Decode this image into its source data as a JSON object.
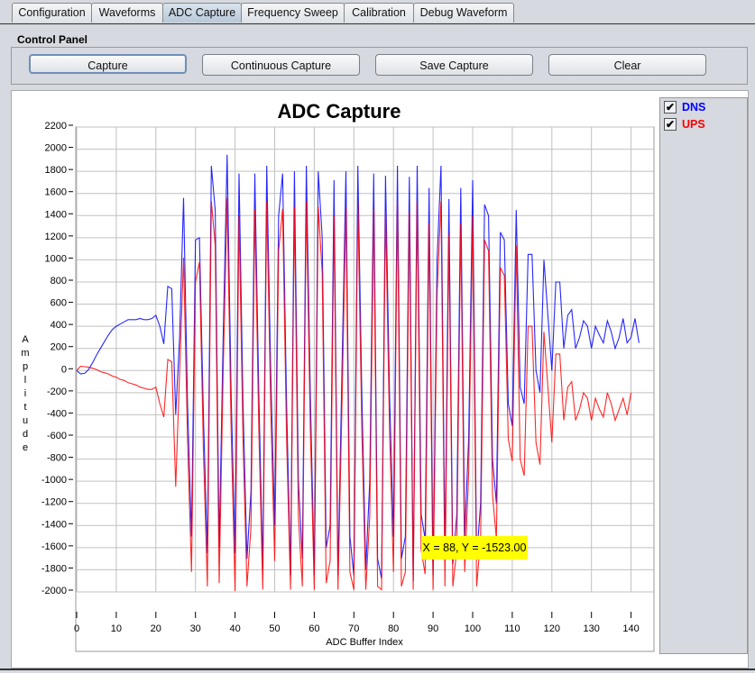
{
  "tabs": [
    {
      "label": "Configuration"
    },
    {
      "label": "Waveforms"
    },
    {
      "label": "ADC Capture",
      "active": true
    },
    {
      "label": "Frequency Sweep"
    },
    {
      "label": "Calibration"
    },
    {
      "label": "Debug Waveform"
    }
  ],
  "control_panel": {
    "title": "Control Panel",
    "buttons": {
      "capture": "Capture",
      "continuous": "Continuous Capture",
      "save": "Save Capture",
      "clear": "Clear"
    }
  },
  "legend": {
    "items": [
      {
        "label": "DNS",
        "checked": true,
        "color": "#0000ff"
      },
      {
        "label": "UPS",
        "checked": true,
        "color": "#ff0000"
      }
    ]
  },
  "tooltip": {
    "text": "X = 88, Y = -1523.00"
  },
  "chart_data": {
    "type": "line",
    "title": "ADC Capture",
    "xlabel": "ADC Buffer Index",
    "ylabel": "Amplitude",
    "xlim": [
      0,
      144
    ],
    "ylim": [
      -2000,
      2200
    ],
    "xticks": [
      0,
      10,
      20,
      30,
      40,
      50,
      60,
      70,
      80,
      90,
      100,
      110,
      120,
      130,
      140
    ],
    "yticks": [
      2200,
      2000,
      1800,
      1600,
      1400,
      1200,
      1000,
      800,
      600,
      400,
      200,
      0,
      -200,
      -400,
      -600,
      -800,
      -1000,
      -1200,
      -1400,
      -1600,
      -1800,
      -2000
    ],
    "grid": true,
    "legend_position": "right",
    "series": [
      {
        "name": "DNS",
        "color": "#0000ff",
        "values": [
          0,
          -30,
          -25,
          10,
          70,
          140,
          200,
          260,
          320,
          370,
          400,
          420,
          440,
          460,
          460,
          460,
          470,
          460,
          460,
          470,
          500,
          400,
          240,
          760,
          740,
          -400,
          300,
          1560,
          -300,
          -1500,
          1180,
          1200,
          -400,
          -1650,
          1850,
          1450,
          -1600,
          300,
          1950,
          -200,
          -1650,
          1780,
          -300,
          -1700,
          -1100,
          1780,
          -200,
          -1800,
          1850,
          0,
          -1400,
          1400,
          1780,
          -300,
          -1850,
          1800,
          -1000,
          -1700,
          1850,
          -200,
          -1850,
          1800,
          1200,
          -1600,
          -1400,
          1720,
          -1850,
          0,
          1800,
          -1500,
          -1850,
          1850,
          -200,
          -1800,
          -1000,
          1780,
          -1700,
          -1880,
          1760,
          -200,
          -1500,
          1850,
          -1700,
          -1500,
          1750,
          -1900,
          1850,
          -1300,
          -1523,
          1650,
          -1850,
          1000,
          1850,
          -1700,
          1550,
          -1750,
          -1300,
          1650,
          -1500,
          -600,
          1720,
          -1700,
          -1200,
          1500,
          1400,
          -800,
          -1200,
          1250,
          1180,
          -300,
          -500,
          1450,
          -150,
          -300,
          1050,
          1050,
          0,
          -200,
          1000,
          500,
          0,
          800,
          800,
          200,
          500,
          550,
          200,
          300,
          450,
          400,
          200,
          400,
          320,
          250,
          450,
          350,
          200,
          300,
          470,
          250,
          300,
          470,
          250
        ]
      },
      {
        "name": "UPS",
        "color": "#ff0000",
        "values": [
          0,
          40,
          35,
          30,
          20,
          10,
          -10,
          -20,
          -30,
          -50,
          -60,
          -80,
          -90,
          -110,
          -120,
          -130,
          -150,
          -160,
          -170,
          -170,
          -150,
          -300,
          -420,
          100,
          80,
          -1050,
          -20,
          1020,
          -620,
          -1820,
          800,
          980,
          -720,
          -1950,
          1530,
          1130,
          -1920,
          -20,
          1560,
          -520,
          -1990,
          1400,
          -620,
          -1950,
          -1420,
          1460,
          -520,
          -1980,
          1530,
          -320,
          -1720,
          1080,
          1460,
          -620,
          -1980,
          1480,
          -1320,
          -1950,
          1530,
          -520,
          -1980,
          1480,
          880,
          -1920,
          -1720,
          1400,
          -1980,
          -320,
          1480,
          -1820,
          -1980,
          1530,
          -520,
          -1980,
          -1320,
          1460,
          -1950,
          -1980,
          1440,
          -520,
          -1820,
          1530,
          -1950,
          -1820,
          1430,
          -1980,
          1530,
          -1620,
          -1840,
          1330,
          -1980,
          680,
          1530,
          -1950,
          1230,
          -1950,
          -1620,
          1330,
          -1820,
          -920,
          1400,
          -1950,
          -1520,
          1180,
          1080,
          -1120,
          -1520,
          930,
          860,
          -620,
          -820,
          1130,
          -800,
          -950,
          400,
          400,
          -650,
          -850,
          350,
          -150,
          -650,
          150,
          150,
          -450,
          -150,
          -100,
          -450,
          -350,
          -200,
          -250,
          -450,
          -250,
          -350,
          -420,
          -200,
          -300,
          -450,
          -350,
          -250,
          -400,
          -200
        ]
      }
    ]
  }
}
